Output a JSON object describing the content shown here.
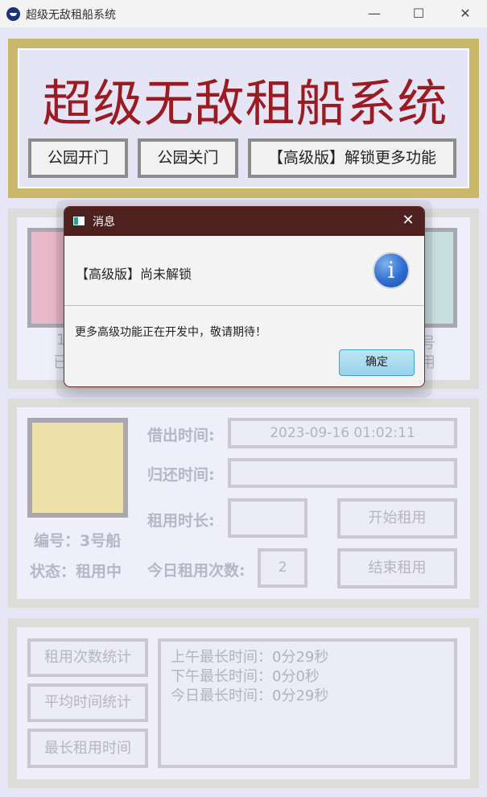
{
  "window": {
    "title": "超级无敌租船系统",
    "controls": {
      "minimize": "—",
      "maximize": "☐",
      "close": "✕"
    }
  },
  "header": {
    "big_title": "超级无敌租船系统",
    "buttons": [
      "公园开门",
      "公园关门",
      "【高级版】解锁更多功能"
    ]
  },
  "boats_panel": {
    "label_fragments": [
      "1",
      "已",
      "号",
      "用"
    ],
    "tile_colors": [
      "#e8b9c8",
      "#c7dfdd"
    ]
  },
  "boat_detail": {
    "boat_color": "#ede0a9",
    "boat_number": "编号：3号船",
    "boat_status": "状态：租用中",
    "lend_time_label": "借出时间:",
    "lend_time_value": "2023-09-16 01:02:11",
    "return_time_label": "归还时间:",
    "return_time_value": "",
    "duration_label": "租用时长:",
    "duration_value": "",
    "start_button": "开始租用",
    "today_count_label": "今日租用次数:",
    "today_count_value": "2",
    "end_button": "结束租用"
  },
  "stats": {
    "buttons": [
      "租用次数统计",
      "平均时间统计",
      "最长租用时间"
    ],
    "lines": [
      "上午最长时间：0分29秒",
      "下午最长时间：0分0秒",
      "今日最长时间：0分29秒"
    ]
  },
  "dialog": {
    "title": "消息",
    "close": "✕",
    "header": "【高级版】尚未解锁",
    "info_icon": "i",
    "content": "更多高级功能正在开发中，敬请期待！",
    "ok": "确定"
  },
  "colors": {
    "title_red": "#9a1c22",
    "header_frame": "#c9b86a",
    "dialog_titlebar": "#4e2020"
  }
}
